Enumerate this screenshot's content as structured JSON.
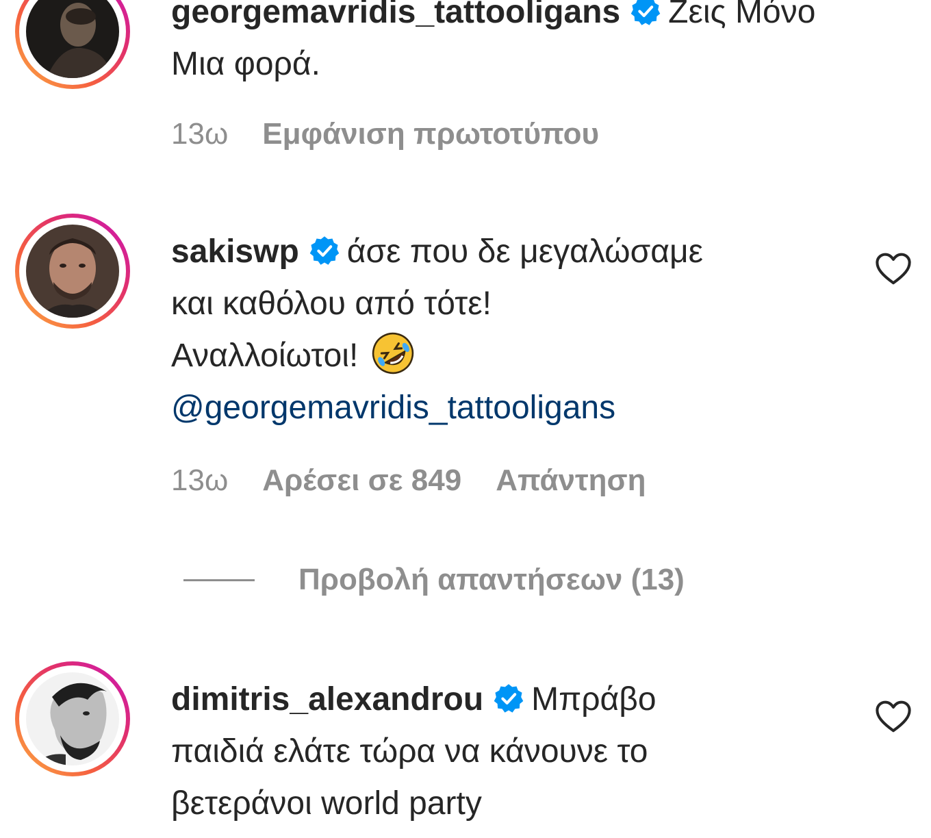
{
  "comments": [
    {
      "username": "georgemavridis_tattooligans",
      "verified": true,
      "text": "Ζεις Μόνο Μια φορά.",
      "time": "13ω",
      "action": "Εμφάνιση πρωτοτύπου",
      "avatar_icon": "profile-photo-dark"
    },
    {
      "username": "sakiswp",
      "verified": true,
      "text_line1": "άσε που δε μεγαλώσαμε",
      "text_line2": "και καθόλου από τότε!",
      "text_line3": "Αναλλοίωτοι!",
      "emoji": "rolling-on-floor-laughing-emoji",
      "mention": "@georgemavridis_tattooligans",
      "time": "13ω",
      "likes": "Αρέσει σε 849",
      "reply": "Απάντηση",
      "avatar_icon": "profile-photo"
    },
    {
      "username": "dimitris_alexandrou",
      "verified": true,
      "text": "Μπράβο",
      "text_line2": "παιδιά ελάτε τώρα να κάνουνε το",
      "text_line3": "βετεράνοι world party",
      "avatar_icon": "profile-photo-bw"
    }
  ],
  "view_replies": "Προβολή απαντήσεων (13)",
  "colors": {
    "text": "#262626",
    "muted": "#8e8e8e",
    "verified": "#0095f6",
    "mention": "#00376b"
  }
}
